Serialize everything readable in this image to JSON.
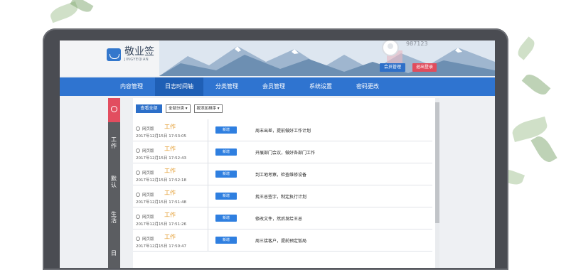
{
  "header": {
    "app_name": "敬业签",
    "app_subtitle": "JINGYEQIAN",
    "user_id": "987123",
    "member_btn": "会员管理",
    "logout_btn": "退出登录"
  },
  "nav": {
    "items": [
      {
        "label": "内容管理"
      },
      {
        "label": "日志时间轴"
      },
      {
        "label": "分类管理"
      },
      {
        "label": "会员管理"
      },
      {
        "label": "系统设置"
      },
      {
        "label": "密码更改"
      }
    ]
  },
  "sidebar": {
    "tabs": [
      {
        "label": "工作"
      },
      {
        "label": "默认"
      },
      {
        "label": "生活"
      },
      {
        "label": "日"
      }
    ]
  },
  "toolbar": {
    "view_all": "查看全部",
    "category_select": "全部分类",
    "sort_select": "按添加排序"
  },
  "rows": [
    {
      "source": "网页版",
      "category": "工作",
      "time": "2017年12月15日 17:53:05",
      "action": "新增",
      "text": "周末出差，提前做好工作计划"
    },
    {
      "source": "网页版",
      "category": "工作",
      "time": "2017年12月15日 17:52:43",
      "action": "新增",
      "text": "开展部门会议，做好各部门工作"
    },
    {
      "source": "网页版",
      "category": "工作",
      "time": "2017年12月15日 17:52:18",
      "action": "新增",
      "text": "到工地考察，检查维修设备"
    },
    {
      "source": "网页版",
      "category": "工作",
      "time": "2017年12月15日 17:51:48",
      "action": "新增",
      "text": "找王总签字，制定执行计划"
    },
    {
      "source": "网页版",
      "category": "工作",
      "time": "2017年12月15日 17:51:26",
      "action": "新增",
      "text": "修改文件，然后发给王总"
    },
    {
      "source": "网页版",
      "category": "工作",
      "time": "2017年12月15日 17:50:47",
      "action": "新增",
      "text": "周三接客户，提前预定饭局"
    }
  ]
}
